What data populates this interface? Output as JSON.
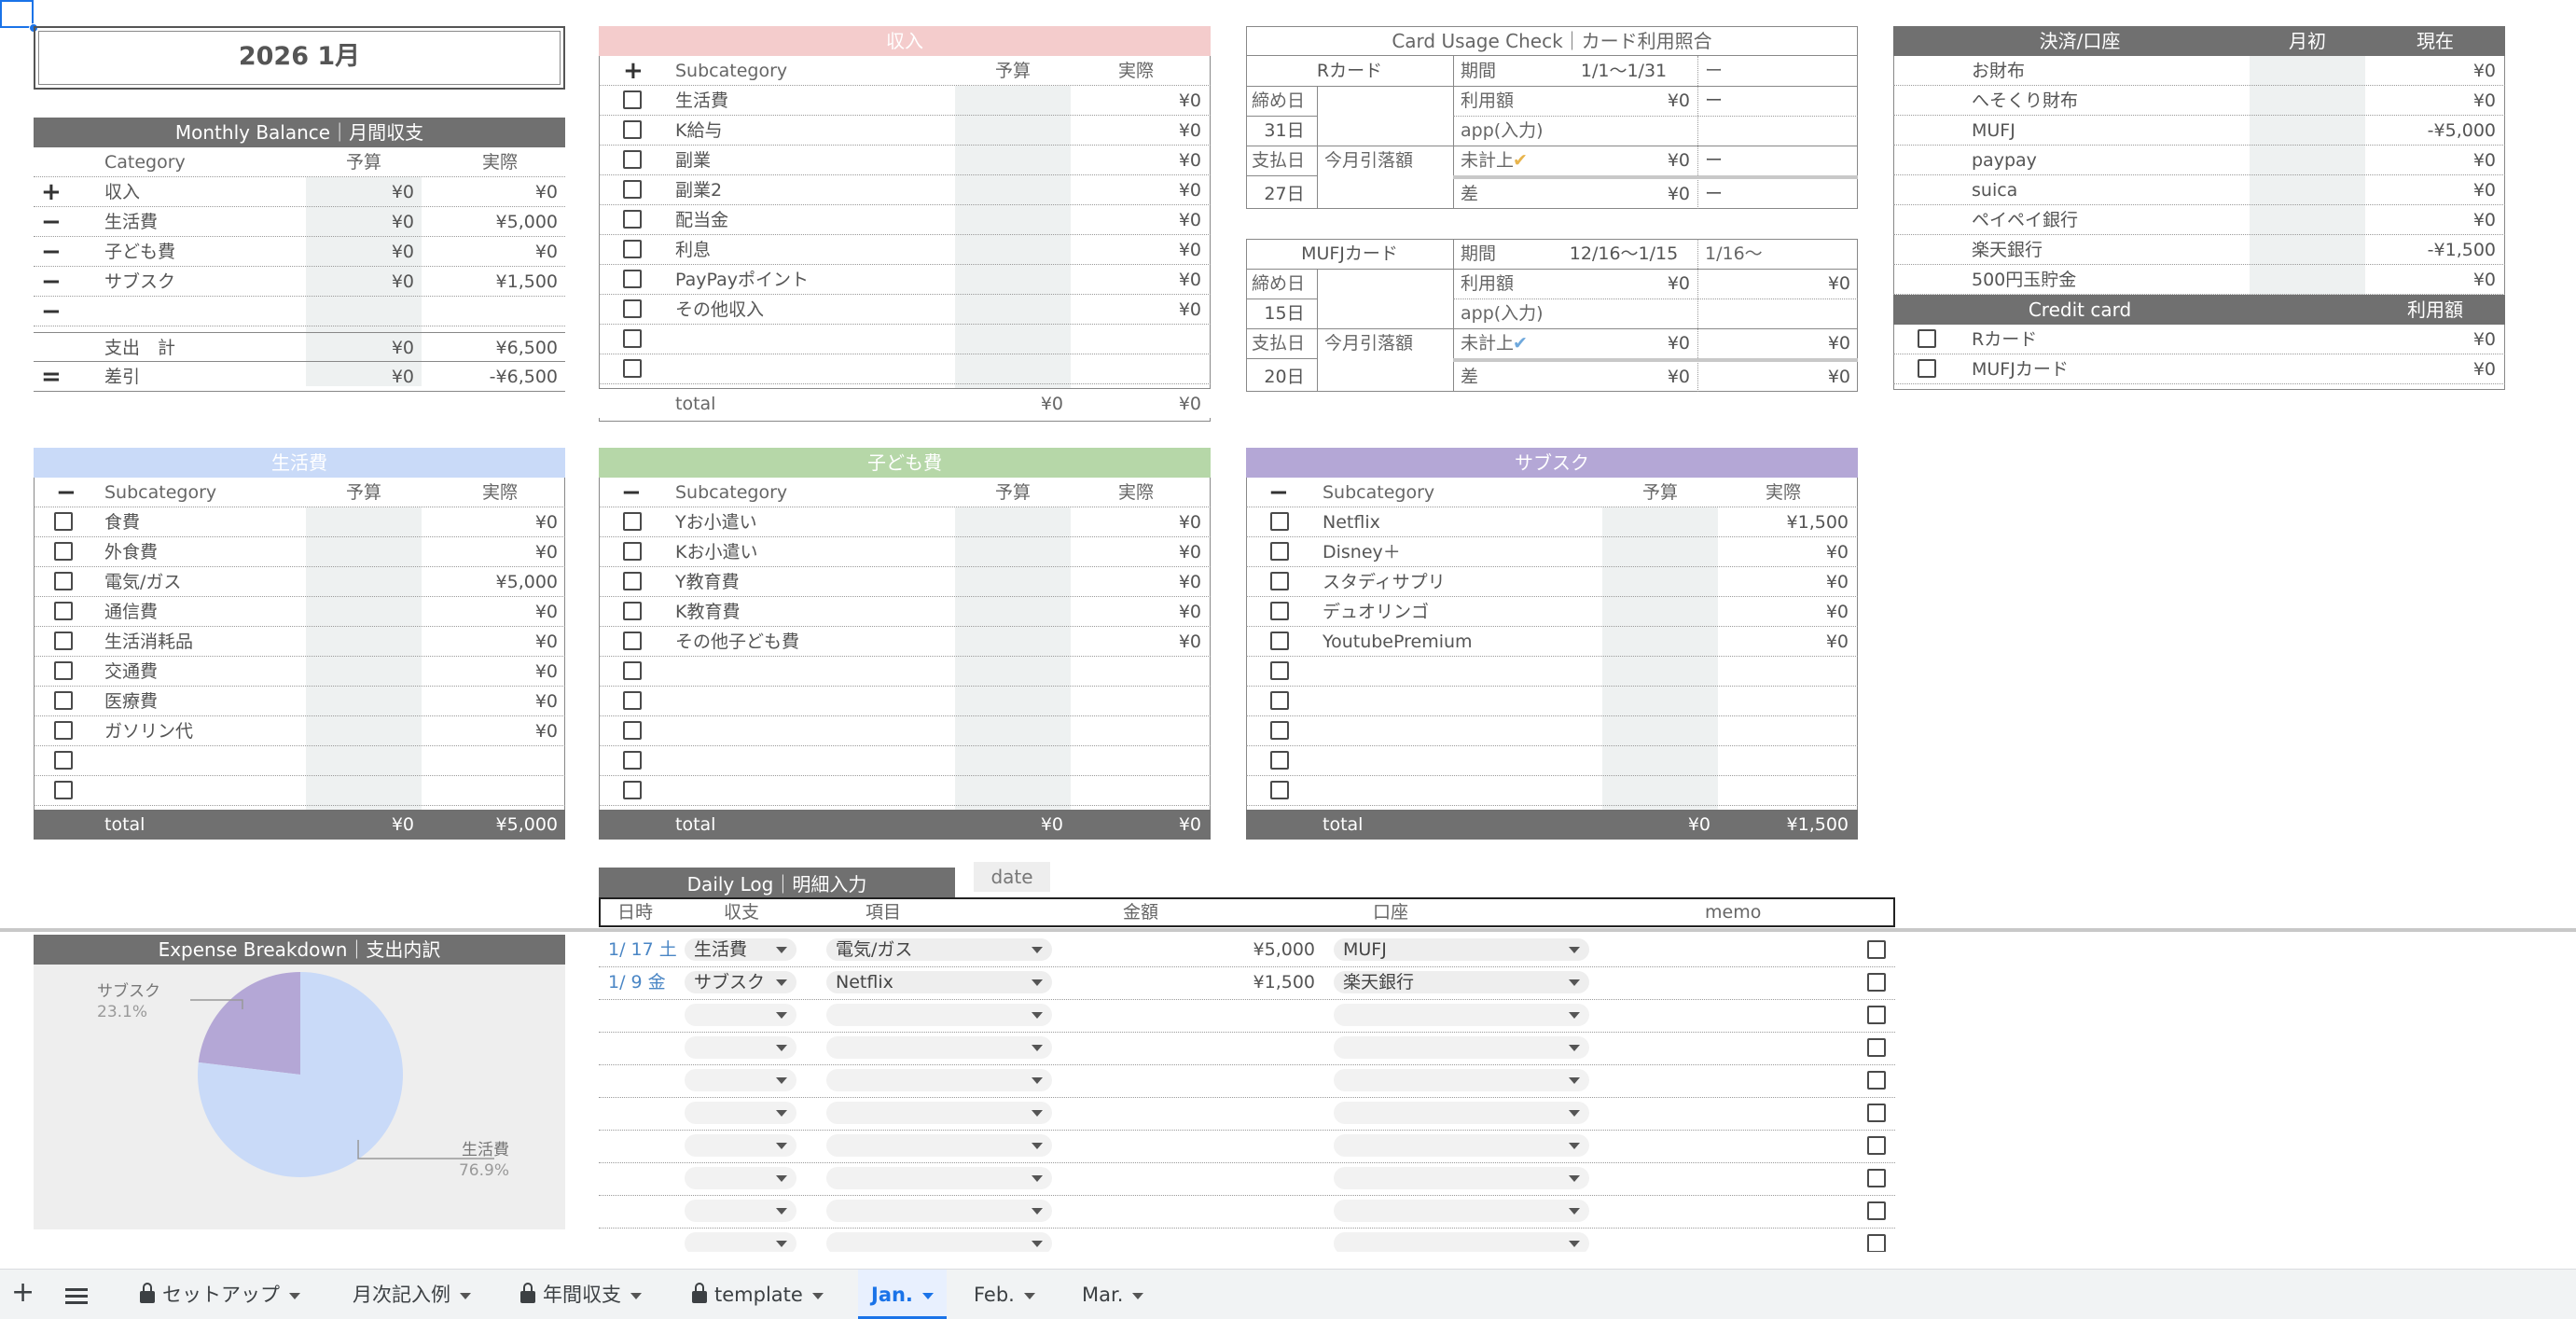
{
  "title": "2026  1月",
  "colors": {
    "income": "#f4cccc",
    "living": "#c9daf8",
    "kids": "#b6d7a8",
    "subs": "#b4a7d6",
    "gray": "#707070"
  },
  "monthly": {
    "header": "Monthly Balance｜月間収支",
    "cols": [
      "Category",
      "予算",
      "実際"
    ],
    "rows": [
      {
        "sign": "+",
        "name": "収入",
        "budget": "¥0",
        "actual": "¥0"
      },
      {
        "sign": "−",
        "name": "生活費",
        "budget": "¥0",
        "actual": "¥5,000"
      },
      {
        "sign": "−",
        "name": "子ども費",
        "budget": "¥0",
        "actual": "¥0"
      },
      {
        "sign": "−",
        "name": "サブスク",
        "budget": "¥0",
        "actual": "¥1,500"
      },
      {
        "sign": "−",
        "name": "",
        "budget": "",
        "actual": ""
      }
    ],
    "total": {
      "name": "支出　計",
      "budget": "¥0",
      "actual": "¥6,500"
    },
    "diff": {
      "sign": "=",
      "name": "差引",
      "budget": "¥0",
      "actual": "-¥6,500"
    }
  },
  "income": {
    "header": "収入",
    "cols": [
      "Subcategory",
      "予算",
      "実際"
    ],
    "rows": [
      {
        "name": "生活費",
        "actual": "¥0"
      },
      {
        "name": "K給与",
        "actual": "¥0"
      },
      {
        "name": "副業",
        "actual": "¥0"
      },
      {
        "name": "副業2",
        "actual": "¥0"
      },
      {
        "name": "配当金",
        "actual": "¥0"
      },
      {
        "name": "利息",
        "actual": "¥0"
      },
      {
        "name": "PayPayポイント",
        "actual": "¥0"
      },
      {
        "name": "その他収入",
        "actual": "¥0"
      },
      {
        "name": "",
        "actual": ""
      },
      {
        "name": "",
        "actual": ""
      }
    ],
    "total": {
      "label": "total",
      "budget": "¥0",
      "actual": "¥0"
    }
  },
  "card": {
    "header": "Card Usage Check｜カード利用照合",
    "r": {
      "name": "Rカード",
      "period_label": "期間",
      "period": "1/1〜1/31",
      "next": "ー",
      "close_label": "締め日",
      "close_day": "31日",
      "usage_label": "利用額",
      "usage": "¥0",
      "usage_next": "ー",
      "app": "app(入力)",
      "pay_label": "支払日",
      "pay_day": "27日",
      "debit_label": "今月引落額",
      "unposted": "未計上",
      "unposted_val": "¥0",
      "unposted_next": "ー",
      "diff": "差",
      "diff_val": "¥0",
      "diff_next": "ー"
    },
    "m": {
      "name": "MUFJカード",
      "period_label": "期間",
      "period": "12/16〜1/15",
      "next": "1/16〜",
      "close_label": "締め日",
      "close_day": "15日",
      "usage_label": "利用額",
      "usage": "¥0",
      "usage_next": "¥0",
      "app": "app(入力)",
      "pay_label": "支払日",
      "pay_day": "20日",
      "debit_label": "今月引落額",
      "unposted": "未計上",
      "unposted_val": "¥0",
      "unposted_next": "¥0",
      "diff": "差",
      "diff_val": "¥0",
      "diff_next": "¥0"
    }
  },
  "accounts": {
    "cols": [
      "決済/口座",
      "月初",
      "現在"
    ],
    "rows": [
      {
        "name": "お財布",
        "value": "¥0"
      },
      {
        "name": "へそくり財布",
        "value": "¥0"
      },
      {
        "name": "MUFJ",
        "value": "-¥5,000"
      },
      {
        "name": "paypay",
        "value": "¥0"
      },
      {
        "name": "suica",
        "value": "¥0"
      },
      {
        "name": "ペイペイ銀行",
        "value": "¥0"
      },
      {
        "name": "楽天銀行",
        "value": "-¥1,500"
      },
      {
        "name": "500円玉貯金",
        "value": "¥0"
      }
    ],
    "cc_cols": [
      "Credit card",
      "利用額"
    ],
    "cc_rows": [
      {
        "name": "Rカード",
        "value": "¥0"
      },
      {
        "name": "MUFJカード",
        "value": "¥0"
      }
    ]
  },
  "living": {
    "header": "生活費",
    "cols": [
      "Subcategory",
      "予算",
      "実際"
    ],
    "rows": [
      {
        "name": "食費",
        "actual": "¥0"
      },
      {
        "name": "外食費",
        "actual": "¥0"
      },
      {
        "name": "電気/ガス",
        "actual": "¥5,000"
      },
      {
        "name": "通信費",
        "actual": "¥0"
      },
      {
        "name": "生活消耗品",
        "actual": "¥0"
      },
      {
        "name": "交通費",
        "actual": "¥0"
      },
      {
        "name": "医療費",
        "actual": "¥0"
      },
      {
        "name": "ガソリン代",
        "actual": "¥0"
      },
      {
        "name": "",
        "actual": ""
      },
      {
        "name": "",
        "actual": ""
      }
    ],
    "total": {
      "label": "total",
      "budget": "¥0",
      "actual": "¥5,000"
    }
  },
  "kids": {
    "header": "子ども費",
    "cols": [
      "Subcategory",
      "予算",
      "実際"
    ],
    "rows": [
      {
        "name": "Yお小遣い",
        "actual": "¥0"
      },
      {
        "name": "Kお小遣い",
        "actual": "¥0"
      },
      {
        "name": "Y教育費",
        "actual": "¥0"
      },
      {
        "name": "K教育費",
        "actual": "¥0"
      },
      {
        "name": "その他子ども費",
        "actual": "¥0"
      },
      {
        "name": "",
        "actual": ""
      },
      {
        "name": "",
        "actual": ""
      },
      {
        "name": "",
        "actual": ""
      },
      {
        "name": "",
        "actual": ""
      },
      {
        "name": "",
        "actual": ""
      }
    ],
    "total": {
      "label": "total",
      "budget": "¥0",
      "actual": "¥0"
    }
  },
  "subs": {
    "header": "サブスク",
    "cols": [
      "Subcategory",
      "予算",
      "実際"
    ],
    "rows": [
      {
        "name": "Netflix",
        "actual": "¥1,500"
      },
      {
        "name": "Disney＋",
        "actual": "¥0"
      },
      {
        "name": "スタディサプリ",
        "actual": "¥0"
      },
      {
        "name": "デュオリンゴ",
        "actual": "¥0"
      },
      {
        "name": "YoutubePremium",
        "actual": "¥0"
      },
      {
        "name": "",
        "actual": ""
      },
      {
        "name": "",
        "actual": ""
      },
      {
        "name": "",
        "actual": ""
      },
      {
        "name": "",
        "actual": ""
      },
      {
        "name": "",
        "actual": ""
      }
    ],
    "total": {
      "label": "total",
      "budget": "¥0",
      "actual": "¥1,500"
    }
  },
  "daily": {
    "header": "Daily Log｜明細入力",
    "date_label": "date",
    "cols": [
      "日時",
      "収支",
      "項目",
      "金額",
      "口座",
      "memo"
    ],
    "rows": [
      {
        "date": "1/ 17 土",
        "type": "生活費",
        "item": "電気/ガス",
        "amount": "¥5,000",
        "account": "MUFJ"
      },
      {
        "date": "1/ 9 金",
        "type": "サブスク",
        "item": "Netflix",
        "amount": "¥1,500",
        "account": "楽天銀行"
      },
      {
        "date": "",
        "type": "",
        "item": "",
        "amount": "",
        "account": ""
      },
      {
        "date": "",
        "type": "",
        "item": "",
        "amount": "",
        "account": ""
      },
      {
        "date": "",
        "type": "",
        "item": "",
        "amount": "",
        "account": ""
      },
      {
        "date": "",
        "type": "",
        "item": "",
        "amount": "",
        "account": ""
      },
      {
        "date": "",
        "type": "",
        "item": "",
        "amount": "",
        "account": ""
      },
      {
        "date": "",
        "type": "",
        "item": "",
        "amount": "",
        "account": ""
      },
      {
        "date": "",
        "type": "",
        "item": "",
        "amount": "",
        "account": ""
      },
      {
        "date": "",
        "type": "",
        "item": "",
        "amount": "",
        "account": ""
      }
    ]
  },
  "breakdown": {
    "header": "Expense Breakdown｜支出内訳"
  },
  "chart_data": {
    "type": "pie",
    "categories": [
      "サブスク",
      "生活費"
    ],
    "values": [
      23.1,
      76.9
    ],
    "labels": [
      "23.1%",
      "76.9%"
    ],
    "colors": [
      "#b4a7d6",
      "#c9daf8"
    ]
  },
  "tabs": [
    {
      "label": "セットアップ",
      "locked": true
    },
    {
      "label": "月次記入例",
      "locked": false
    },
    {
      "label": "年間収支",
      "locked": true
    },
    {
      "label": "template",
      "locked": true
    },
    {
      "label": "Jan.",
      "locked": false,
      "active": true
    },
    {
      "label": "Feb.",
      "locked": false
    },
    {
      "label": "Mar.",
      "locked": false
    }
  ]
}
